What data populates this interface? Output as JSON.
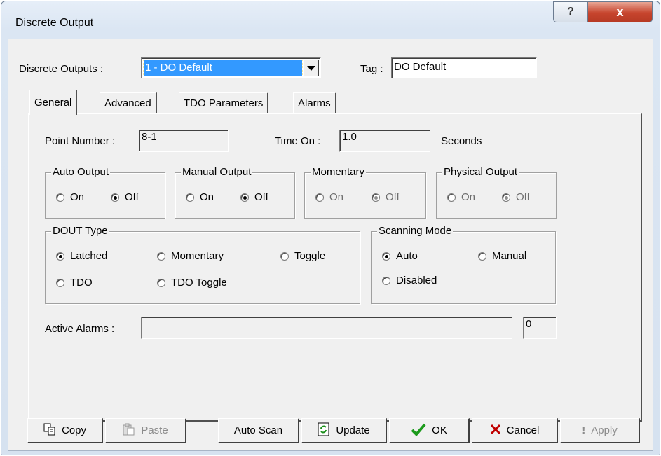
{
  "window": {
    "title": "Discrete Output",
    "help_icon": "?",
    "close_icon": "x"
  },
  "header": {
    "outputs_label": "Discrete Outputs :",
    "outputs_value": "1 - DO Default",
    "tag_label": "Tag :",
    "tag_value": "DO Default"
  },
  "tabs": [
    {
      "label": "General",
      "active": true
    },
    {
      "label": "Advanced",
      "active": false
    },
    {
      "label": "TDO Parameters",
      "active": false
    },
    {
      "label": "Alarms",
      "active": false
    }
  ],
  "general": {
    "point_number_label": "Point Number :",
    "point_number_value": "8-1",
    "time_on_label": "Time On :",
    "time_on_value": "1.0",
    "time_on_unit": "Seconds",
    "auto_output": {
      "title": "Auto Output",
      "on": "On",
      "off": "Off",
      "selected": "Off"
    },
    "manual_output": {
      "title": "Manual Output",
      "on": "On",
      "off": "Off",
      "selected": "Off"
    },
    "momentary": {
      "title": "Momentary",
      "on": "On",
      "off": "Off",
      "selected": "Off",
      "disabled": true
    },
    "physical_output": {
      "title": "Physical Output",
      "on": "On",
      "off": "Off",
      "selected": "Off",
      "disabled": true
    },
    "dout_type": {
      "title": "DOUT Type",
      "options": [
        "Latched",
        "Momentary",
        "Toggle",
        "TDO",
        "TDO Toggle"
      ],
      "selected": "Latched"
    },
    "scanning_mode": {
      "title": "Scanning Mode",
      "options": [
        "Auto",
        "Manual",
        "Disabled"
      ],
      "selected": "Auto"
    },
    "active_alarms_label": "Active Alarms :",
    "active_alarms_value": "",
    "active_alarms_count": "0"
  },
  "buttons": {
    "copy": "Copy",
    "paste": "Paste",
    "auto_scan": "Auto Scan",
    "update": "Update",
    "ok": "OK",
    "cancel": "Cancel",
    "apply": "Apply"
  }
}
